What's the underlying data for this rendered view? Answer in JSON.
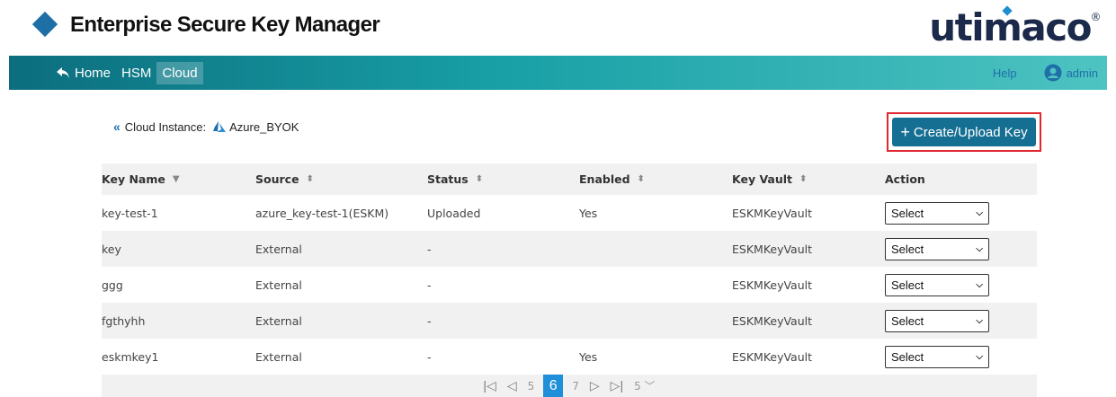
{
  "app": {
    "title": "Enterprise Secure Key Manager",
    "logo_text": "utimaco",
    "logo_mark": "®",
    "accent": "#156f93"
  },
  "nav": {
    "items": [
      {
        "label": "Home",
        "icon": "home-arrow-icon"
      },
      {
        "label": "HSM"
      },
      {
        "label": "Cloud",
        "active": true
      }
    ],
    "help": "Help",
    "user": "admin"
  },
  "instance": {
    "chevron": "«",
    "label": "Cloud Instance:",
    "name": "Azure_BYOK"
  },
  "create_button": {
    "plus": "+",
    "label": "Create/Upload Key"
  },
  "table": {
    "columns": [
      "Key Name",
      "Source",
      "Status",
      "Enabled",
      "Key Vault",
      "Action"
    ],
    "rows": [
      {
        "name": "key-test-1",
        "source": "azure_key-test-1(ESKM)",
        "status": "Uploaded",
        "enabled": "Yes",
        "vault": "ESKMKeyVault",
        "action": "Select"
      },
      {
        "name": "key",
        "source": "External",
        "status": "-",
        "enabled": "",
        "vault": "ESKMKeyVault",
        "action": "Select"
      },
      {
        "name": "ggg",
        "source": "External",
        "status": "-",
        "enabled": "",
        "vault": "ESKMKeyVault",
        "action": "Select"
      },
      {
        "name": "fgthyhh",
        "source": "External",
        "status": "-",
        "enabled": "",
        "vault": "ESKMKeyVault",
        "action": "Select"
      },
      {
        "name": "eskmkey1",
        "source": "External",
        "status": "-",
        "enabled": "Yes",
        "vault": "ESKMKeyVault",
        "action": "Select"
      }
    ]
  },
  "pagination": {
    "pages": [
      "5",
      "6",
      "7"
    ],
    "current": "6",
    "page_size": "5"
  }
}
